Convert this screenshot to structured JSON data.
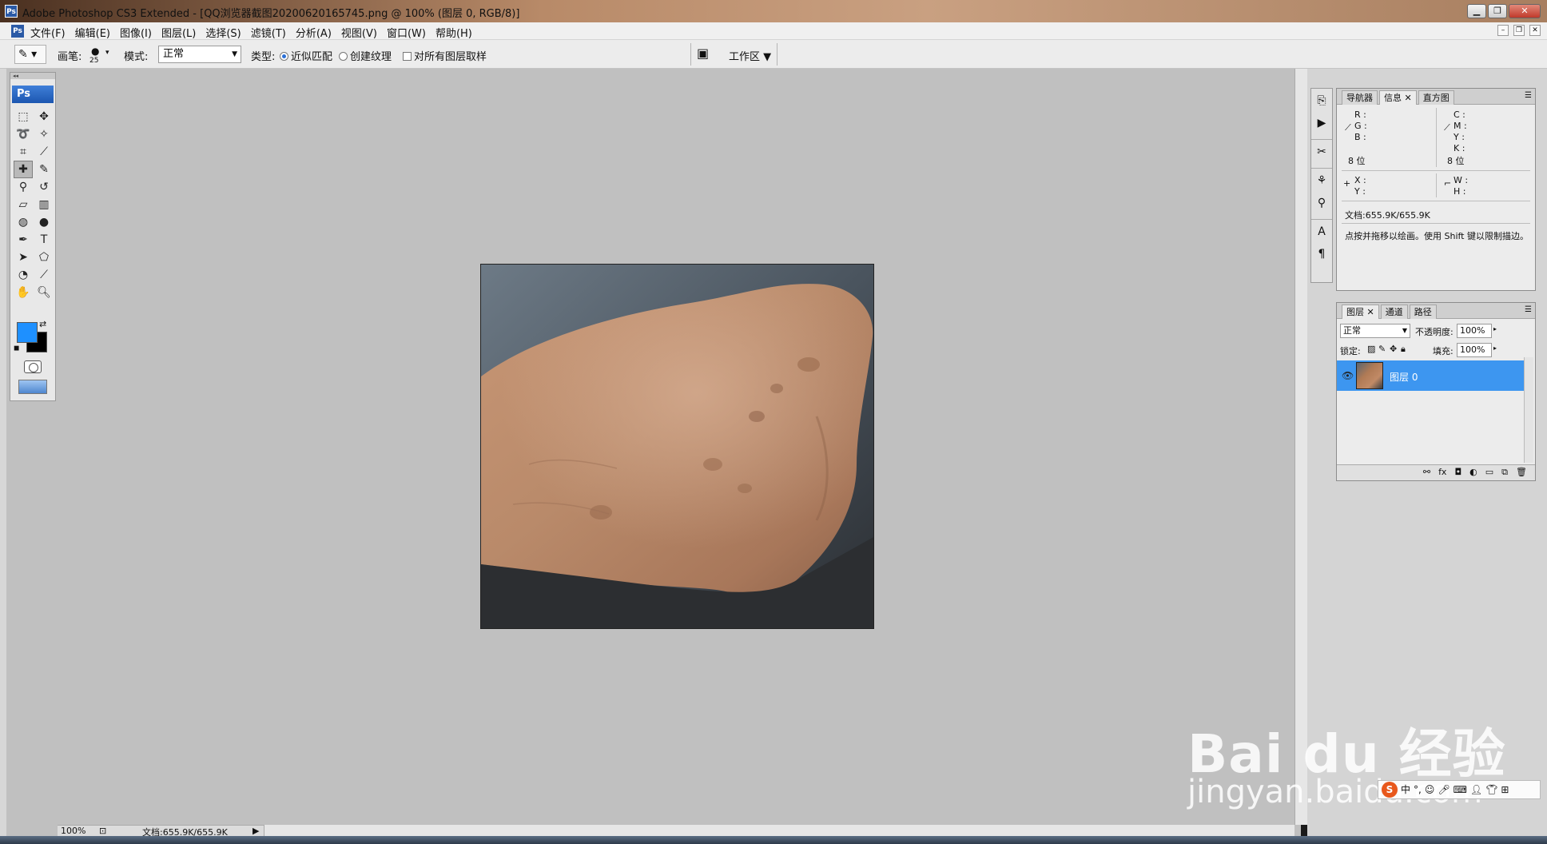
{
  "window": {
    "title": "Adobe Photoshop CS3 Extended - [QQ浏览器截图20200620165745.png @ 100% (图层 0, RGB/8)]",
    "app_icon": "Ps"
  },
  "menu": {
    "items": [
      "文件(F)",
      "编辑(E)",
      "图像(I)",
      "图层(L)",
      "选择(S)",
      "滤镜(T)",
      "分析(A)",
      "视图(V)",
      "窗口(W)",
      "帮助(H)"
    ]
  },
  "options": {
    "brush_label": "画笔:",
    "brush_size": "25",
    "mode_label": "模式:",
    "mode_value": "正常",
    "type_label": "类型:",
    "type_option1": "近似匹配",
    "type_option2": "创建纹理",
    "sample_all_label": "对所有图层取样",
    "workspace_label": "工作区"
  },
  "toolbox": {
    "logo": "Ps"
  },
  "colors": {
    "foreground": "#1e90ff",
    "background": "#000000",
    "layer_selected": "#3d96f0"
  },
  "statusbar": {
    "zoom": "100%",
    "doc_info": "文档:655.9K/655.9K"
  },
  "info_panel": {
    "tabs": [
      "导航器",
      "信息",
      "直方图"
    ],
    "active_tab": "信息",
    "r": "R :",
    "g": "G :",
    "b": "B :",
    "bits_left": "8 位",
    "c": "C :",
    "m": "M :",
    "y": "Y :",
    "k": "K :",
    "bits_right": "8 位",
    "x": "X :",
    "yy": "Y :",
    "w": "W :",
    "h": "H :",
    "doc": "文档:655.9K/655.9K",
    "hint": "点按并拖移以绘画。使用 Shift 键以限制描边。"
  },
  "layers_panel": {
    "tabs": [
      "图层",
      "通道",
      "路径"
    ],
    "active_tab": "图层",
    "blend_mode": "正常",
    "opacity_label": "不透明度:",
    "opacity_value": "100%",
    "lock_label": "锁定:",
    "fill_label": "填充:",
    "fill_value": "100%",
    "layers": [
      {
        "name": "图层 0",
        "visible": true,
        "selected": true
      }
    ]
  },
  "watermark": {
    "logo_text": "Bai du 经验",
    "url": "jingyan.baidu.com"
  }
}
